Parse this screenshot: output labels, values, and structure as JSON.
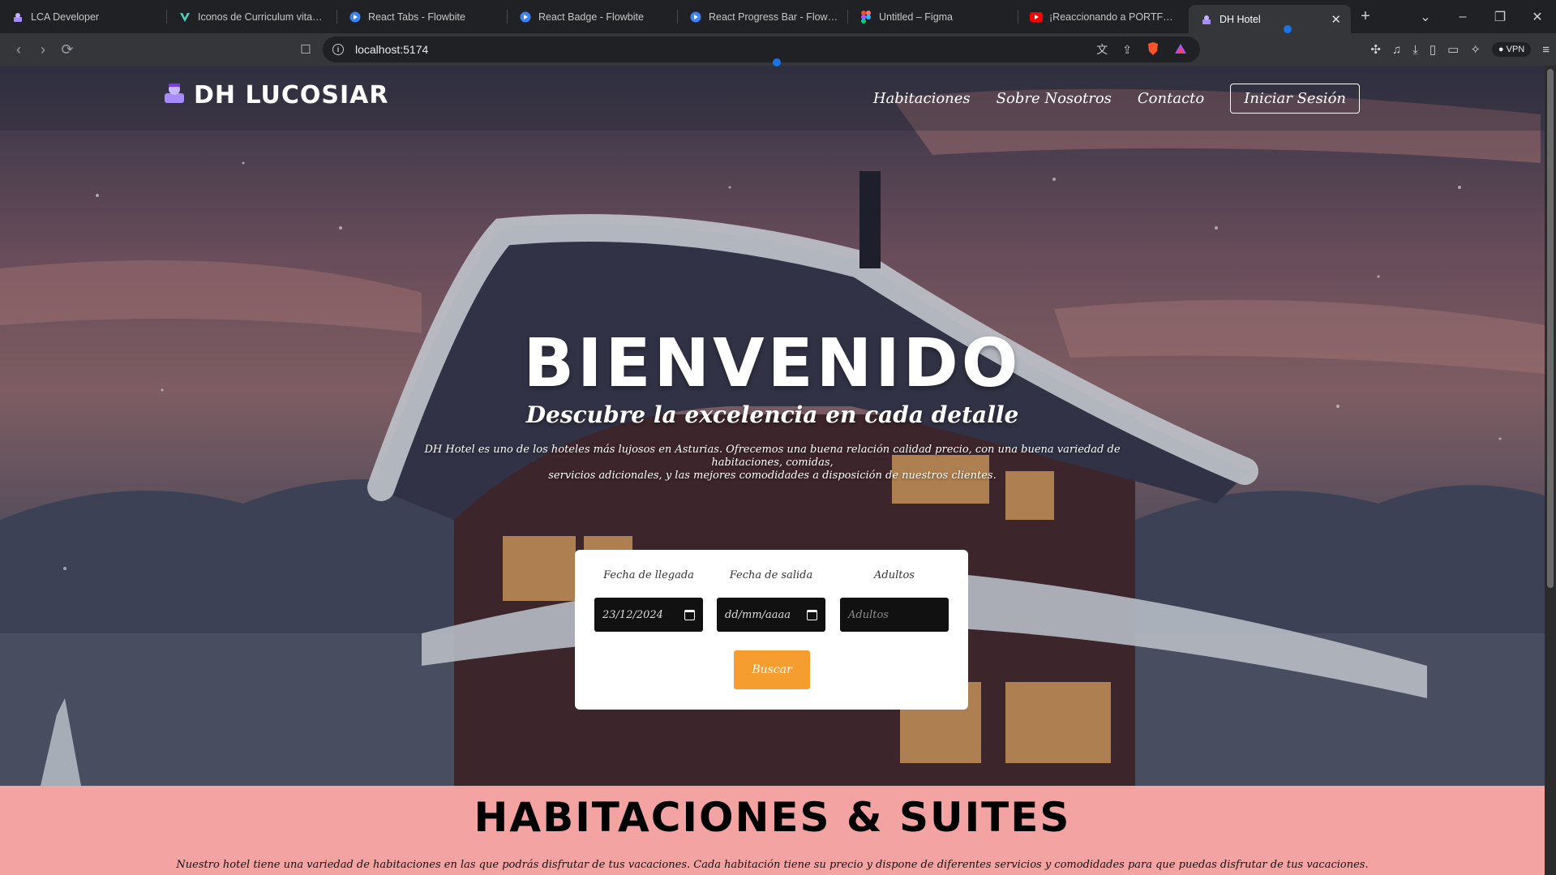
{
  "browser": {
    "tabs": [
      {
        "title": "LCA Developer",
        "icon": "purple-logo-icon",
        "active": false
      },
      {
        "title": "Iconos de Curriculum vitae - Ic",
        "icon": "vuetify-icon",
        "active": false
      },
      {
        "title": "React Tabs - Flowbite",
        "icon": "flowbite-icon",
        "active": false
      },
      {
        "title": "React Badge - Flowbite",
        "icon": "flowbite-icon",
        "active": false
      },
      {
        "title": "React Progress Bar - Flowbite",
        "icon": "flowbite-icon",
        "active": false
      },
      {
        "title": "Untitled – Figma",
        "icon": "figma-icon",
        "active": false
      },
      {
        "title": "¡Reaccionando a PORTFOLIOS",
        "icon": "youtube-icon",
        "active": false
      },
      {
        "title": "DH Hotel",
        "icon": "purple-logo-icon",
        "active": true
      }
    ],
    "url": "localhost:5174",
    "vpn_label": "VPN"
  },
  "nav": {
    "logo_text": "DH LUCOSIAR",
    "links": [
      "Habitaciones",
      "Sobre Nosotros",
      "Contacto"
    ],
    "login_label": "Iniciar Sesión"
  },
  "hero": {
    "title": "BIENVENIDO",
    "subtitle": "Descubre la excelencia en cada detalle",
    "description_line1": "DH Hotel es uno de los hoteles más lujosos en Asturias. Ofrecemos una buena relación calidad precio, con una buena variedad de habitaciones, comidas,",
    "description_line2": "servicios adicionales, y las mejores comodidades a disposición de nuestros clientes."
  },
  "booking": {
    "arrival_label": "Fecha de llegada",
    "arrival_value": "23/12/2024",
    "departure_label": "Fecha de salida",
    "departure_placeholder": "dd/mm/aaaa",
    "adults_label": "Adultos",
    "adults_placeholder": "Adultos",
    "search_label": "Buscar"
  },
  "rooms": {
    "title": "HABITACIONES & SUITES",
    "description": "Nuestro hotel tiene una variedad de habitaciones en las que podrás disfrutar de tus vacaciones. Cada habitación tiene su precio y dispone de diferentes servicios y comodidades para que puedas disfrutar de tus vacaciones."
  },
  "colors": {
    "accent_orange": "#f59e2f",
    "rooms_bg": "#f4a3a3",
    "logo_purple": "#a78bfa"
  }
}
